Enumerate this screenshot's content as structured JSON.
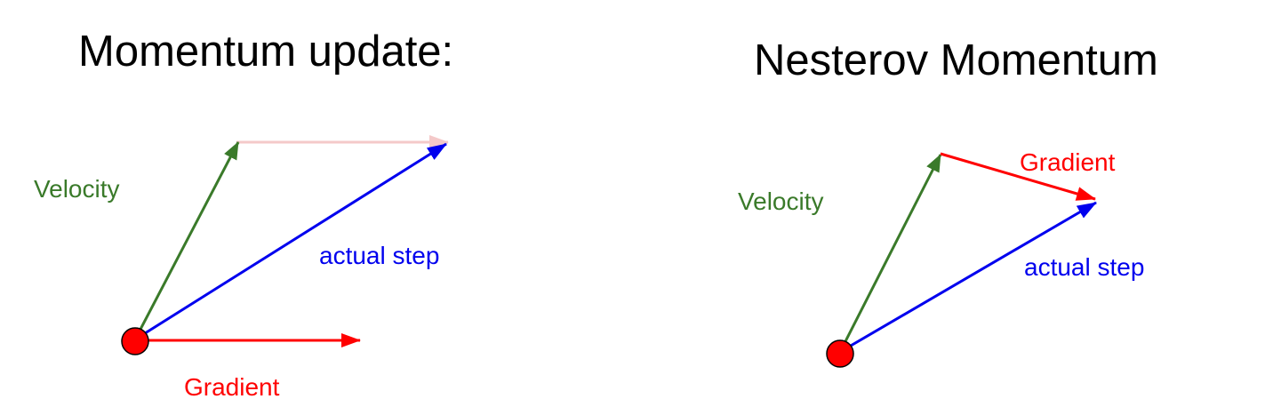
{
  "colors": {
    "velocity": "#3a7a2a",
    "gradient": "#ff0000",
    "actual_step": "#0000ee",
    "ghost_gradient": "#f4c9c9",
    "point_fill": "#ff0000",
    "point_stroke": "#000000"
  },
  "momentum": {
    "title": "Momentum update:",
    "velocity_label": "Velocity",
    "actual_step_label": "actual step",
    "gradient_label": "Gradient"
  },
  "nesterov": {
    "title": "Nesterov Momentum",
    "velocity_label": "Velocity",
    "gradient_label": "Gradient",
    "actual_step_label": "actual step"
  }
}
